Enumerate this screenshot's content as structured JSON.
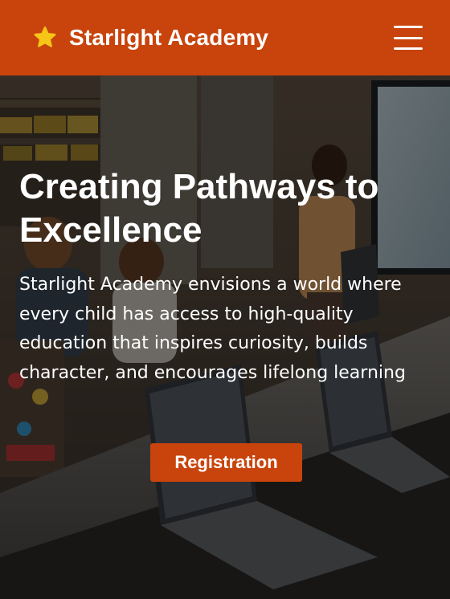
{
  "header": {
    "brand_name": "Starlight Academy",
    "brand_icon": "star-icon",
    "menu_icon": "hamburger-menu-icon"
  },
  "hero": {
    "title": "Creating Pathways to Excellence",
    "description": "Starlight Academy envisions a world where every child has access to high-quality education that inspires curiosity, builds character, and encourages lifelong learning",
    "cta_label": "Registration"
  },
  "colors": {
    "brand_orange": "#c8440c",
    "star_yellow": "#f5c518",
    "text_white": "#ffffff"
  }
}
